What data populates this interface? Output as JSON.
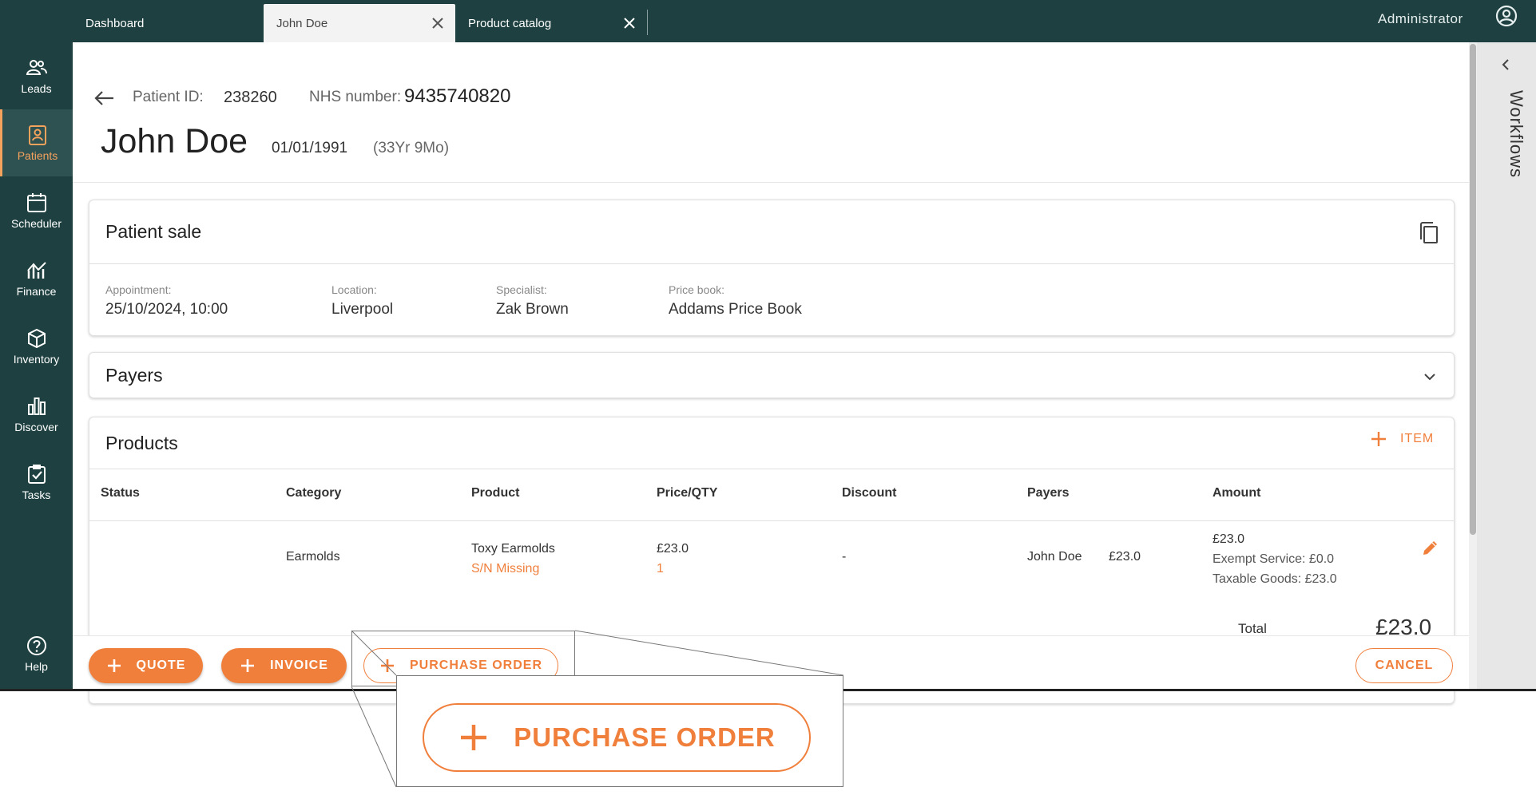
{
  "tabs": [
    {
      "label": "Dashboard"
    },
    {
      "label": "John Doe"
    },
    {
      "label": "Product catalog"
    }
  ],
  "user": {
    "name": "Administrator"
  },
  "nav": {
    "items": [
      {
        "label": "Leads",
        "icon": "people-icon"
      },
      {
        "label": "Patients",
        "icon": "patient-card-icon"
      },
      {
        "label": "Scheduler",
        "icon": "calendar-icon"
      },
      {
        "label": "Finance",
        "icon": "finance-chart-icon"
      },
      {
        "label": "Inventory",
        "icon": "box-icon"
      },
      {
        "label": "Discover",
        "icon": "bar-chart-icon"
      },
      {
        "label": "Tasks",
        "icon": "task-check-icon"
      }
    ],
    "help": "Help"
  },
  "patient": {
    "id_label": "Patient ID:",
    "id": "238260",
    "nhs_label": "NHS number:",
    "nhs": "9435740820",
    "name": "John Doe",
    "dob": "01/01/1991",
    "age": "(33Yr 9Mo)"
  },
  "sale": {
    "title": "Patient sale",
    "appointment_label": "Appointment:",
    "appointment": "25/10/2024, 10:00",
    "location_label": "Location:",
    "location": "Liverpool",
    "specialist_label": "Specialist:",
    "specialist": "Zak Brown",
    "pricebook_label": "Price book:",
    "pricebook": "Addams Price Book"
  },
  "payers": {
    "title": "Payers"
  },
  "products": {
    "title": "Products",
    "add_item": "ITEM",
    "columns": [
      "Status",
      "Category",
      "Product",
      "Price/QTY",
      "Discount",
      "Payers",
      "Amount"
    ],
    "rows": [
      {
        "status": "",
        "category": "Earmolds",
        "product": "Toxy Earmolds",
        "product_note": "S/N Missing",
        "price": "£23.0",
        "qty": "1",
        "discount": "-",
        "payer": "John Doe",
        "payer_amount": "£23.0",
        "amount": "£23.0",
        "exempt": "Exempt Service: £0.0",
        "taxable": "Taxable Goods: £23.0"
      }
    ],
    "total_label_fragment": "Total",
    "total_value_fragment": "£23.0"
  },
  "actions": {
    "quote": "QUOTE",
    "invoice": "INVOICE",
    "purchase_order": "PURCHASE ORDER",
    "cancel": "CANCEL"
  },
  "workflows": {
    "label": "Workflows"
  },
  "zoom": {
    "label": "PURCHASE ORDER"
  },
  "colors": {
    "brand_dark": "#1e4040",
    "accent": "#f07f3c"
  }
}
